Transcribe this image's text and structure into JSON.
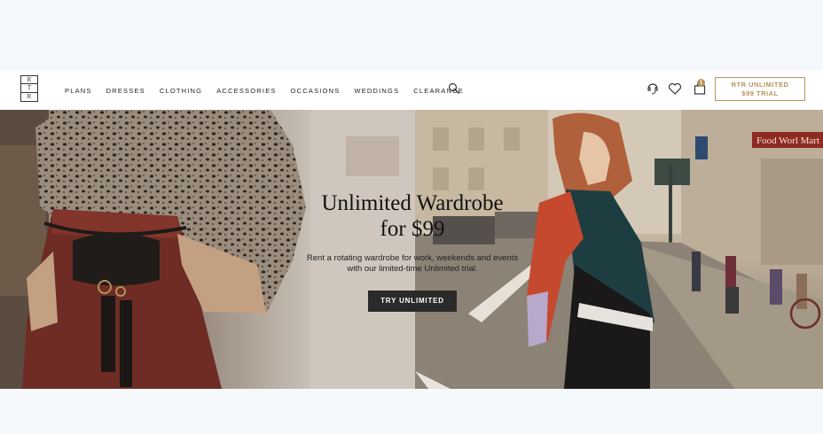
{
  "nav": {
    "logo_letters": [
      "R",
      "T",
      "R"
    ],
    "links": [
      "PLANS",
      "DRESSES",
      "CLOTHING",
      "ACCESSORIES",
      "OCCASIONS",
      "WEDDINGS",
      "CLEARANCE"
    ],
    "bag_count": "1",
    "trial_line1": "RTR UNLIMITED",
    "trial_line2": "$99 TRIAL",
    "icons": [
      "search-icon",
      "chat-icon",
      "heart-icon",
      "bag-icon"
    ]
  },
  "hero": {
    "title_line1": "Unlimited Wardrobe",
    "title_line2": "for $99",
    "subtitle_line1": "Rent a rotating wardrobe for work, weekends and events",
    "subtitle_line2": "with our limited-time Unlimited trial.",
    "cta": "TRY UNLIMITED",
    "street_sign": "Food Worl Mart"
  },
  "colors": {
    "accent": "#b8935a",
    "cta_bg": "#2a2a2a",
    "page_bg": "#f5f9fc"
  }
}
